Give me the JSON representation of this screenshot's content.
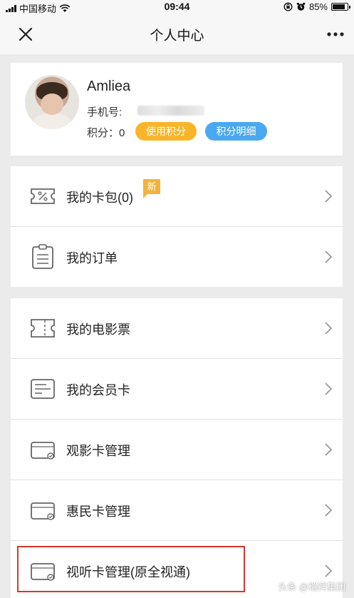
{
  "status_bar": {
    "carrier": "中国移动",
    "time": "09:44",
    "battery": "85%"
  },
  "navbar": {
    "title": "个人中心",
    "close_icon": "close-icon",
    "more_icon": "more-icon"
  },
  "profile": {
    "username": "Amliea",
    "phone_label": "手机号:",
    "points_label": "积分：0",
    "use_points_button": "使用积分",
    "points_detail_button": "积分明细"
  },
  "group1": [
    {
      "label": "我的卡包(0)",
      "icon": "coupon-icon",
      "badge": "新"
    },
    {
      "label": "我的订单",
      "icon": "order-icon"
    }
  ],
  "group2": [
    {
      "label": "我的电影票",
      "icon": "ticket-icon"
    },
    {
      "label": "我的会员卡",
      "icon": "member-card-icon"
    },
    {
      "label": "观影卡管理",
      "icon": "card-icon"
    },
    {
      "label": "惠民卡管理",
      "icon": "card-icon"
    },
    {
      "label": "视听卡管理(原全视通)",
      "icon": "card-icon"
    }
  ],
  "watermark": "头条 @瑞祥集团",
  "colors": {
    "accent_orange": "#f9b52a",
    "accent_blue": "#4aa8f0",
    "highlight_red": "#d9362f",
    "background": "#ebebeb"
  }
}
